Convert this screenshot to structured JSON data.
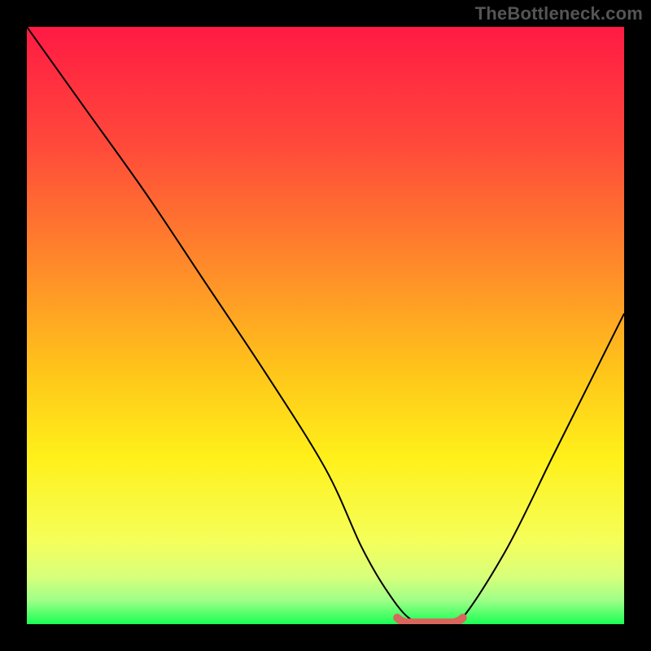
{
  "watermark": "TheBottleneck.com",
  "chart_data": {
    "type": "line",
    "title": "",
    "xlabel": "",
    "ylabel": "",
    "xlim": [
      0,
      100
    ],
    "ylim": [
      0,
      100
    ],
    "grid": false,
    "legend": false,
    "annotations": [],
    "series": [
      {
        "name": "curve",
        "x": [
          0,
          10,
          20,
          30,
          40,
          50,
          56,
          60,
          64,
          68,
          72,
          80,
          88,
          94,
          100
        ],
        "values": [
          100,
          86,
          72,
          57,
          42,
          26,
          13,
          6,
          1,
          0,
          0,
          12,
          28,
          40,
          52
        ]
      }
    ],
    "flat_region": {
      "x_start": 62,
      "x_end": 73,
      "y": 0.8,
      "color": "#d9665c"
    },
    "background_gradient": {
      "stops": [
        {
          "offset": 0.0,
          "color": "#ff1a44"
        },
        {
          "offset": 0.2,
          "color": "#ff4a3a"
        },
        {
          "offset": 0.4,
          "color": "#ff8a2a"
        },
        {
          "offset": 0.58,
          "color": "#ffc61a"
        },
        {
          "offset": 0.72,
          "color": "#fff01a"
        },
        {
          "offset": 0.86,
          "color": "#f5ff5a"
        },
        {
          "offset": 0.92,
          "color": "#d8ff7a"
        },
        {
          "offset": 0.96,
          "color": "#9fff88"
        },
        {
          "offset": 1.0,
          "color": "#1aff55"
        }
      ]
    }
  }
}
